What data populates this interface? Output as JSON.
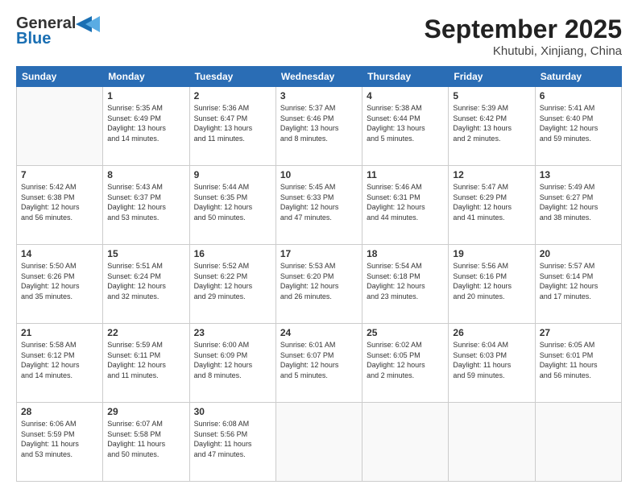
{
  "header": {
    "logo_general": "General",
    "logo_blue": "Blue",
    "title": "September 2025",
    "subtitle": "Khutubi, Xinjiang, China"
  },
  "days_of_week": [
    "Sunday",
    "Monday",
    "Tuesday",
    "Wednesday",
    "Thursday",
    "Friday",
    "Saturday"
  ],
  "weeks": [
    [
      {
        "day": "",
        "info": ""
      },
      {
        "day": "1",
        "info": "Sunrise: 5:35 AM\nSunset: 6:49 PM\nDaylight: 13 hours\nand 14 minutes."
      },
      {
        "day": "2",
        "info": "Sunrise: 5:36 AM\nSunset: 6:47 PM\nDaylight: 13 hours\nand 11 minutes."
      },
      {
        "day": "3",
        "info": "Sunrise: 5:37 AM\nSunset: 6:46 PM\nDaylight: 13 hours\nand 8 minutes."
      },
      {
        "day": "4",
        "info": "Sunrise: 5:38 AM\nSunset: 6:44 PM\nDaylight: 13 hours\nand 5 minutes."
      },
      {
        "day": "5",
        "info": "Sunrise: 5:39 AM\nSunset: 6:42 PM\nDaylight: 13 hours\nand 2 minutes."
      },
      {
        "day": "6",
        "info": "Sunrise: 5:41 AM\nSunset: 6:40 PM\nDaylight: 12 hours\nand 59 minutes."
      }
    ],
    [
      {
        "day": "7",
        "info": "Sunrise: 5:42 AM\nSunset: 6:38 PM\nDaylight: 12 hours\nand 56 minutes."
      },
      {
        "day": "8",
        "info": "Sunrise: 5:43 AM\nSunset: 6:37 PM\nDaylight: 12 hours\nand 53 minutes."
      },
      {
        "day": "9",
        "info": "Sunrise: 5:44 AM\nSunset: 6:35 PM\nDaylight: 12 hours\nand 50 minutes."
      },
      {
        "day": "10",
        "info": "Sunrise: 5:45 AM\nSunset: 6:33 PM\nDaylight: 12 hours\nand 47 minutes."
      },
      {
        "day": "11",
        "info": "Sunrise: 5:46 AM\nSunset: 6:31 PM\nDaylight: 12 hours\nand 44 minutes."
      },
      {
        "day": "12",
        "info": "Sunrise: 5:47 AM\nSunset: 6:29 PM\nDaylight: 12 hours\nand 41 minutes."
      },
      {
        "day": "13",
        "info": "Sunrise: 5:49 AM\nSunset: 6:27 PM\nDaylight: 12 hours\nand 38 minutes."
      }
    ],
    [
      {
        "day": "14",
        "info": "Sunrise: 5:50 AM\nSunset: 6:26 PM\nDaylight: 12 hours\nand 35 minutes."
      },
      {
        "day": "15",
        "info": "Sunrise: 5:51 AM\nSunset: 6:24 PM\nDaylight: 12 hours\nand 32 minutes."
      },
      {
        "day": "16",
        "info": "Sunrise: 5:52 AM\nSunset: 6:22 PM\nDaylight: 12 hours\nand 29 minutes."
      },
      {
        "day": "17",
        "info": "Sunrise: 5:53 AM\nSunset: 6:20 PM\nDaylight: 12 hours\nand 26 minutes."
      },
      {
        "day": "18",
        "info": "Sunrise: 5:54 AM\nSunset: 6:18 PM\nDaylight: 12 hours\nand 23 minutes."
      },
      {
        "day": "19",
        "info": "Sunrise: 5:56 AM\nSunset: 6:16 PM\nDaylight: 12 hours\nand 20 minutes."
      },
      {
        "day": "20",
        "info": "Sunrise: 5:57 AM\nSunset: 6:14 PM\nDaylight: 12 hours\nand 17 minutes."
      }
    ],
    [
      {
        "day": "21",
        "info": "Sunrise: 5:58 AM\nSunset: 6:12 PM\nDaylight: 12 hours\nand 14 minutes."
      },
      {
        "day": "22",
        "info": "Sunrise: 5:59 AM\nSunset: 6:11 PM\nDaylight: 12 hours\nand 11 minutes."
      },
      {
        "day": "23",
        "info": "Sunrise: 6:00 AM\nSunset: 6:09 PM\nDaylight: 12 hours\nand 8 minutes."
      },
      {
        "day": "24",
        "info": "Sunrise: 6:01 AM\nSunset: 6:07 PM\nDaylight: 12 hours\nand 5 minutes."
      },
      {
        "day": "25",
        "info": "Sunrise: 6:02 AM\nSunset: 6:05 PM\nDaylight: 12 hours\nand 2 minutes."
      },
      {
        "day": "26",
        "info": "Sunrise: 6:04 AM\nSunset: 6:03 PM\nDaylight: 11 hours\nand 59 minutes."
      },
      {
        "day": "27",
        "info": "Sunrise: 6:05 AM\nSunset: 6:01 PM\nDaylight: 11 hours\nand 56 minutes."
      }
    ],
    [
      {
        "day": "28",
        "info": "Sunrise: 6:06 AM\nSunset: 5:59 PM\nDaylight: 11 hours\nand 53 minutes."
      },
      {
        "day": "29",
        "info": "Sunrise: 6:07 AM\nSunset: 5:58 PM\nDaylight: 11 hours\nand 50 minutes."
      },
      {
        "day": "30",
        "info": "Sunrise: 6:08 AM\nSunset: 5:56 PM\nDaylight: 11 hours\nand 47 minutes."
      },
      {
        "day": "",
        "info": ""
      },
      {
        "day": "",
        "info": ""
      },
      {
        "day": "",
        "info": ""
      },
      {
        "day": "",
        "info": ""
      }
    ]
  ]
}
